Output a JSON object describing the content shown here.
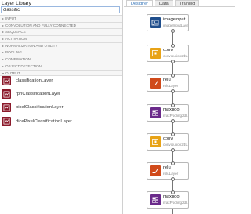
{
  "left_panel": {
    "title": "Layer Library",
    "search_value": "classific",
    "categories": [
      "INPUT",
      "CONVOLUTION AND FULLY CONNECTED",
      "SEQUENCE",
      "ACTIVATION",
      "NORMALIZATION AND UTILITY",
      "POOLING",
      "COMBINATION",
      "OBJECT DETECTION",
      "OUTPUT"
    ],
    "results": [
      {
        "label": "classificationLayer",
        "icon": "output-layer-icon"
      },
      {
        "label": "rpnClassificationLayer",
        "icon": "output-layer-icon"
      },
      {
        "label": "pixelClassificationLayer",
        "icon": "output-layer-icon"
      },
      {
        "label": "dicePixelClassificationLayer",
        "icon": "output-layer-icon"
      }
    ]
  },
  "tabs": [
    {
      "label": "Designer",
      "active": true
    },
    {
      "label": "Data",
      "active": false
    },
    {
      "label": "Training",
      "active": false
    }
  ],
  "network": {
    "nodes": [
      {
        "type": "imageinput",
        "name": "imageInputLayer",
        "icon": "image-input-icon",
        "color": "#1f4e8c"
      },
      {
        "type": "conv",
        "name": "convolution2dL...",
        "icon": "convolution-icon",
        "color": "#e8a317"
      },
      {
        "type": "relu",
        "name": "reluLayer",
        "icon": "relu-icon",
        "color": "#d04a1a"
      },
      {
        "type": "maxpool",
        "name": "maxPooling2dL...",
        "icon": "pooling-icon",
        "color": "#6a2a8a"
      },
      {
        "type": "conv",
        "name": "convolution2dL...",
        "icon": "convolution-icon",
        "color": "#e8a317"
      },
      {
        "type": "relu",
        "name": "reluLayer",
        "icon": "relu-icon",
        "color": "#d04a1a"
      },
      {
        "type": "maxpool",
        "name": "maxPooling2dL...",
        "icon": "pooling-icon",
        "color": "#6a2a8a"
      }
    ]
  },
  "colors": {
    "output_layer": "#8b1a2b",
    "tab_active_text": "#2d6fb5"
  }
}
